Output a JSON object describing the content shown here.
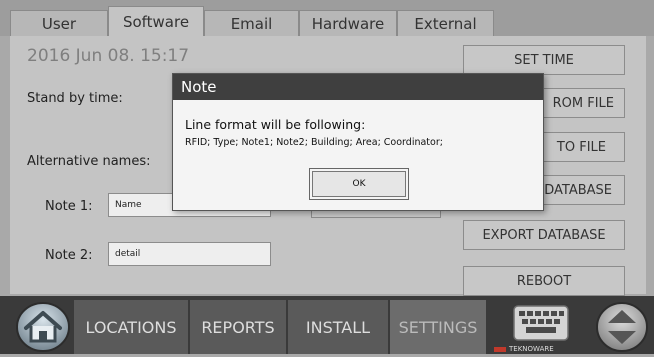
{
  "tabs": [
    "User",
    "Software",
    "Email",
    "Hardware",
    "External"
  ],
  "active_tab": "Software",
  "datetime": "2016 Jun 08. 15:17",
  "labels": {
    "standby": "Stand by time:",
    "alt_names": "Alternative names:",
    "note1": "Note 1:",
    "note2": "Note 2:"
  },
  "fields": {
    "note1_value": "Name",
    "note2_value": "detail"
  },
  "buttons": {
    "set_time": "SET TIME",
    "from_file": "ROM FILE",
    "to_file": "TO FILE",
    "database": "DATABASE",
    "export_database": "EXPORT DATABASE",
    "reboot": "REBOOT"
  },
  "dialog": {
    "title": "Note",
    "message": "Line format will be following:",
    "format": "RFID; Type; Note1; Note2; Building; Area; Coordinator;",
    "ok": "OK"
  },
  "nav": [
    "LOCATIONS",
    "REPORTS",
    "INSTALL",
    "SETTINGS"
  ],
  "active_nav": "SETTINGS",
  "brand": "TEKNOWARE",
  "colors": {
    "dialog_title_bg": "#3f3f3f",
    "nav_bg": "#3a3a3a",
    "brand_red": "#c0392b"
  }
}
